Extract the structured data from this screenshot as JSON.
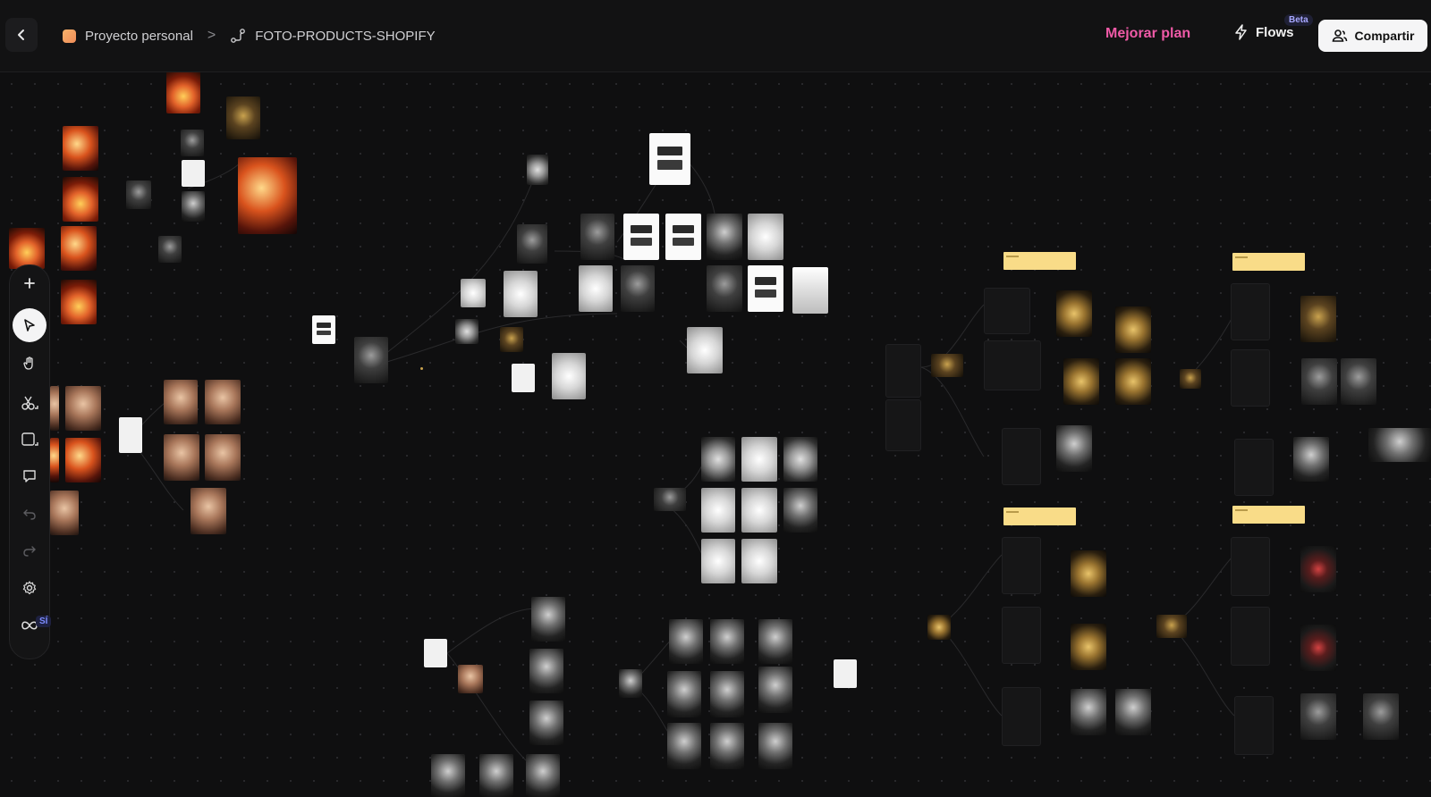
{
  "header": {
    "project_name": "Proyecto personal",
    "separator": ">",
    "flow_name": "FOTO-PRODUCTS-SHOPIFY",
    "upgrade_label": "Mejorar plan",
    "flows_label": "Flows",
    "beta_label": "Beta",
    "share_label": "Compartir"
  },
  "toolbar": {
    "tools": [
      "add-icon",
      "pointer-icon",
      "hand-icon",
      "scissors-icon",
      "frame-icon",
      "comment-icon",
      "undo-icon",
      "redo-icon",
      "settings-icon",
      "infinity-icon"
    ],
    "badge": "SÍ"
  },
  "colors": {
    "accent_upgrade": "#ef5aa7",
    "canvas_bg": "#0f0f10",
    "sticky_note": "#f9dc88"
  }
}
